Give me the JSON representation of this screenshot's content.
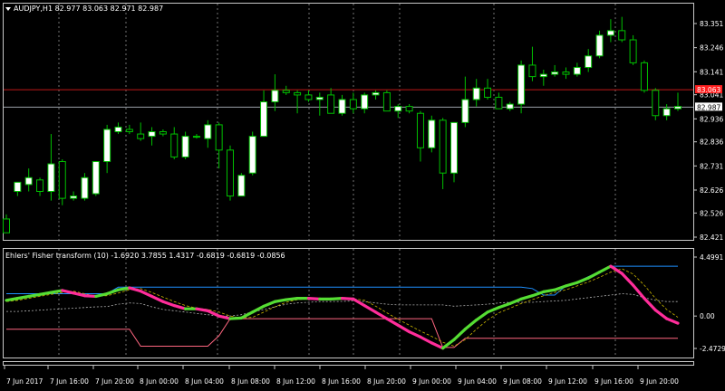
{
  "chart": {
    "symbol_line": "AUDJPY,H1  82.977 83.063 82.971 82.987",
    "price_ticks": [
      "83.351",
      "83.246",
      "83.141",
      "83.041",
      "82.936",
      "82.836",
      "82.731",
      "82.626",
      "82.526",
      "82.421"
    ],
    "price_min": 82.421,
    "price_max": 83.351,
    "bid_price": "83.063",
    "ask_price": "82.987",
    "colors": {
      "background": "#000000",
      "bull_candle": "#ffffff",
      "bear_candle": "#000000",
      "wick": "#00c000",
      "bid_line": "#c01818",
      "bid_tag": "#ff2020",
      "ask_line": "#9aa0a8",
      "grid": "#c0c0c0"
    }
  },
  "indicator": {
    "label": "Ehlers' Fisher transform (10) -1.6920 3.7855 1.4317 -0.6819 -0.6819 -0.0856",
    "ticks": [
      "4.4991",
      "0.00",
      "-2.4729"
    ],
    "min": -2.4729,
    "max": 4.4991,
    "colors": {
      "up": "#55dd33",
      "down": "#ff2d9a",
      "trigger": "#c8b400",
      "band_high": "#1e90ff",
      "band_low": "#ff6680",
      "band_mid": "#b0b0b0"
    }
  },
  "time_axis": {
    "labels": [
      "7 Jun 2017",
      "7 Jun 16:00",
      "7 Jun 20:00",
      "8 Jun 00:00",
      "8 Jun 04:00",
      "8 Jun 08:00",
      "8 Jun 12:00",
      "8 Jun 16:00",
      "8 Jun 20:00",
      "9 Jun 00:00",
      "9 Jun 04:00",
      "9 Jun 08:00",
      "9 Jun 12:00",
      "9 Jun 16:00",
      "9 Jun 20:00"
    ]
  },
  "chart_data": {
    "type": "candlestick",
    "candles": [
      {
        "o": 82.5,
        "h": 82.52,
        "l": 82.44,
        "c": 82.44
      },
      {
        "o": 82.62,
        "h": 82.66,
        "l": 82.6,
        "c": 82.66
      },
      {
        "o": 82.65,
        "h": 82.72,
        "l": 82.62,
        "c": 82.68
      },
      {
        "o": 82.67,
        "h": 82.68,
        "l": 82.6,
        "c": 82.62
      },
      {
        "o": 82.62,
        "h": 82.87,
        "l": 82.58,
        "c": 82.74
      },
      {
        "o": 82.75,
        "h": 82.76,
        "l": 82.56,
        "c": 82.59
      },
      {
        "o": 82.59,
        "h": 82.62,
        "l": 82.58,
        "c": 82.6
      },
      {
        "o": 82.59,
        "h": 82.7,
        "l": 82.58,
        "c": 82.68
      },
      {
        "o": 82.61,
        "h": 82.75,
        "l": 82.6,
        "c": 82.75
      },
      {
        "o": 82.75,
        "h": 82.91,
        "l": 82.7,
        "c": 82.89
      },
      {
        "o": 82.88,
        "h": 82.92,
        "l": 82.87,
        "c": 82.9
      },
      {
        "o": 82.89,
        "h": 82.91,
        "l": 82.87,
        "c": 82.88
      },
      {
        "o": 82.87,
        "h": 82.92,
        "l": 82.84,
        "c": 82.85
      },
      {
        "o": 82.86,
        "h": 82.9,
        "l": 82.82,
        "c": 82.88
      },
      {
        "o": 82.88,
        "h": 82.89,
        "l": 82.86,
        "c": 82.87
      },
      {
        "o": 82.87,
        "h": 82.9,
        "l": 82.76,
        "c": 82.77
      },
      {
        "o": 82.77,
        "h": 82.88,
        "l": 82.76,
        "c": 82.86
      },
      {
        "o": 82.86,
        "h": 82.87,
        "l": 82.85,
        "c": 82.86
      },
      {
        "o": 82.85,
        "h": 82.93,
        "l": 82.81,
        "c": 82.91
      },
      {
        "o": 82.91,
        "h": 82.92,
        "l": 82.72,
        "c": 82.8
      },
      {
        "o": 82.8,
        "h": 82.82,
        "l": 82.58,
        "c": 82.6
      },
      {
        "o": 82.6,
        "h": 82.7,
        "l": 82.6,
        "c": 82.69
      },
      {
        "o": 82.7,
        "h": 82.88,
        "l": 82.69,
        "c": 82.86
      },
      {
        "o": 82.86,
        "h": 83.06,
        "l": 82.86,
        "c": 83.01
      },
      {
        "o": 83.01,
        "h": 83.13,
        "l": 82.97,
        "c": 83.06
      },
      {
        "o": 83.06,
        "h": 83.08,
        "l": 83.04,
        "c": 83.05
      },
      {
        "o": 83.05,
        "h": 83.06,
        "l": 82.96,
        "c": 83.04
      },
      {
        "o": 83.04,
        "h": 83.06,
        "l": 83.01,
        "c": 83.02
      },
      {
        "o": 83.02,
        "h": 83.05,
        "l": 82.95,
        "c": 83.03
      },
      {
        "o": 83.04,
        "h": 83.07,
        "l": 82.96,
        "c": 82.96
      },
      {
        "o": 82.96,
        "h": 83.04,
        "l": 82.95,
        "c": 83.02
      },
      {
        "o": 83.02,
        "h": 83.05,
        "l": 82.96,
        "c": 82.98
      },
      {
        "o": 82.98,
        "h": 83.05,
        "l": 82.96,
        "c": 83.04
      },
      {
        "o": 83.04,
        "h": 83.06,
        "l": 83.02,
        "c": 83.05
      },
      {
        "o": 83.05,
        "h": 83.06,
        "l": 82.97,
        "c": 82.97
      },
      {
        "o": 82.97,
        "h": 83.0,
        "l": 82.94,
        "c": 82.99
      },
      {
        "o": 82.99,
        "h": 83.0,
        "l": 82.96,
        "c": 82.97
      },
      {
        "o": 82.96,
        "h": 82.97,
        "l": 82.75,
        "c": 82.81
      },
      {
        "o": 82.81,
        "h": 82.95,
        "l": 82.79,
        "c": 82.93
      },
      {
        "o": 82.93,
        "h": 82.94,
        "l": 82.63,
        "c": 82.7
      },
      {
        "o": 82.7,
        "h": 82.92,
        "l": 82.66,
        "c": 82.92
      },
      {
        "o": 82.92,
        "h": 83.12,
        "l": 82.9,
        "c": 83.02
      },
      {
        "o": 83.02,
        "h": 83.11,
        "l": 82.99,
        "c": 83.07
      },
      {
        "o": 83.07,
        "h": 83.11,
        "l": 83.02,
        "c": 83.03
      },
      {
        "o": 83.03,
        "h": 83.05,
        "l": 82.98,
        "c": 82.98
      },
      {
        "o": 82.98,
        "h": 83.01,
        "l": 82.97,
        "c": 83.0
      },
      {
        "o": 83.0,
        "h": 83.19,
        "l": 82.96,
        "c": 83.17
      },
      {
        "o": 83.17,
        "h": 83.25,
        "l": 83.1,
        "c": 83.12
      },
      {
        "o": 83.12,
        "h": 83.15,
        "l": 83.08,
        "c": 83.13
      },
      {
        "o": 83.13,
        "h": 83.17,
        "l": 83.12,
        "c": 83.14
      },
      {
        "o": 83.14,
        "h": 83.16,
        "l": 83.11,
        "c": 83.13
      },
      {
        "o": 83.13,
        "h": 83.18,
        "l": 83.12,
        "c": 83.16
      },
      {
        "o": 83.16,
        "h": 83.24,
        "l": 83.14,
        "c": 83.21
      },
      {
        "o": 83.21,
        "h": 83.32,
        "l": 83.2,
        "c": 83.3
      },
      {
        "o": 83.3,
        "h": 83.37,
        "l": 83.27,
        "c": 83.32
      },
      {
        "o": 83.32,
        "h": 83.38,
        "l": 83.27,
        "c": 83.28
      },
      {
        "o": 83.28,
        "h": 83.3,
        "l": 83.17,
        "c": 83.18
      },
      {
        "o": 83.18,
        "h": 83.19,
        "l": 83.05,
        "c": 83.06
      },
      {
        "o": 83.06,
        "h": 83.07,
        "l": 82.93,
        "c": 82.95
      },
      {
        "o": 82.95,
        "h": 83.0,
        "l": 82.93,
        "c": 82.98
      },
      {
        "o": 82.98,
        "h": 83.05,
        "l": 82.97,
        "c": 82.99
      }
    ],
    "fisher": [
      1.2,
      1.35,
      1.5,
      1.65,
      1.8,
      1.95,
      1.75,
      1.55,
      1.5,
      1.7,
      2.0,
      2.15,
      1.9,
      1.5,
      1.1,
      0.8,
      0.55,
      0.55,
      0.4,
      0.0,
      -0.2,
      -0.15,
      0.3,
      0.75,
      1.1,
      1.25,
      1.35,
      1.35,
      1.3,
      1.3,
      1.35,
      1.3,
      0.8,
      0.3,
      -0.2,
      -0.7,
      -1.2,
      -1.6,
      -2.05,
      -2.45,
      -1.8,
      -1.0,
      -0.3,
      0.3,
      0.65,
      0.95,
      1.3,
      1.55,
      1.85,
      2.0,
      2.3,
      2.55,
      2.9,
      3.35,
      3.8,
      3.25,
      2.35,
      1.35,
      0.45,
      -0.2,
      -0.55
    ],
    "trigger": [
      1.1,
      1.2,
      1.35,
      1.5,
      1.65,
      1.8,
      1.9,
      1.7,
      1.5,
      1.55,
      1.75,
      2.0,
      2.1,
      1.8,
      1.45,
      1.1,
      0.8,
      0.6,
      0.5,
      0.3,
      0.0,
      -0.15,
      -0.1,
      0.3,
      0.7,
      1.05,
      1.25,
      1.32,
      1.35,
      1.32,
      1.3,
      1.32,
      1.2,
      0.75,
      0.25,
      -0.25,
      -0.7,
      -1.15,
      -1.55,
      -2.0,
      -2.3,
      -1.8,
      -1.0,
      -0.3,
      0.25,
      0.6,
      0.95,
      1.25,
      1.55,
      1.8,
      2.0,
      2.3,
      2.6,
      2.95,
      3.35,
      3.6,
      3.2,
      2.35,
      1.35,
      0.5,
      -0.1
    ],
    "band_high": [
      1.7,
      1.7,
      1.7,
      1.7,
      1.7,
      1.7,
      1.7,
      1.7,
      1.7,
      1.7,
      2.2,
      2.2,
      2.2,
      2.2,
      2.2,
      2.2,
      2.2,
      2.2,
      2.2,
      2.2,
      2.2,
      2.2,
      2.2,
      2.2,
      2.2,
      2.2,
      2.2,
      2.2,
      2.2,
      2.2,
      2.2,
      2.2,
      2.2,
      2.2,
      2.2,
      2.2,
      2.2,
      2.2,
      2.2,
      2.2,
      2.2,
      2.2,
      2.2,
      2.2,
      2.2,
      2.2,
      2.2,
      2.1,
      1.6,
      1.6,
      2.3,
      2.6,
      3.0,
      3.4,
      3.8,
      3.8,
      3.8,
      3.8,
      3.8,
      3.8,
      3.8
    ],
    "band_low": [
      -1.0,
      -1.0,
      -1.0,
      -1.0,
      -1.0,
      -1.0,
      -1.0,
      -1.0,
      -1.0,
      -1.0,
      -1.0,
      -1.0,
      -2.3,
      -2.3,
      -2.3,
      -2.3,
      -2.3,
      -2.3,
      -2.3,
      -1.5,
      -0.2,
      -0.2,
      -0.2,
      -0.2,
      -0.2,
      -0.2,
      -0.2,
      -0.2,
      -0.2,
      -0.2,
      -0.2,
      -0.2,
      -0.2,
      -0.2,
      -0.2,
      -0.2,
      -0.2,
      -0.2,
      -0.2,
      -2.4,
      -2.4,
      -1.7,
      -1.7,
      -1.7,
      -1.7,
      -1.7,
      -1.7,
      -1.7,
      -1.7,
      -1.7,
      -1.7,
      -1.7,
      -1.7,
      -1.7,
      -1.7,
      -1.7,
      -1.7,
      -1.7,
      -1.7,
      -1.7,
      -1.7
    ],
    "band_mid": [
      0.35,
      0.35,
      0.4,
      0.45,
      0.5,
      0.55,
      0.6,
      0.65,
      0.7,
      0.72,
      0.9,
      1.0,
      0.95,
      0.7,
      0.5,
      0.4,
      0.3,
      0.2,
      0.1,
      0.0,
      0.0,
      0.1,
      0.3,
      0.5,
      0.7,
      0.9,
      1.0,
      1.05,
      1.1,
      1.1,
      1.12,
      1.15,
      1.1,
      1.0,
      0.9,
      0.85,
      0.85,
      0.85,
      0.85,
      0.85,
      0.75,
      0.8,
      0.85,
      0.9,
      1.0,
      1.05,
      1.05,
      1.05,
      1.1,
      1.15,
      1.2,
      1.3,
      1.4,
      1.5,
      1.6,
      1.7,
      1.65,
      1.4,
      1.2,
      1.1,
      1.1
    ]
  }
}
